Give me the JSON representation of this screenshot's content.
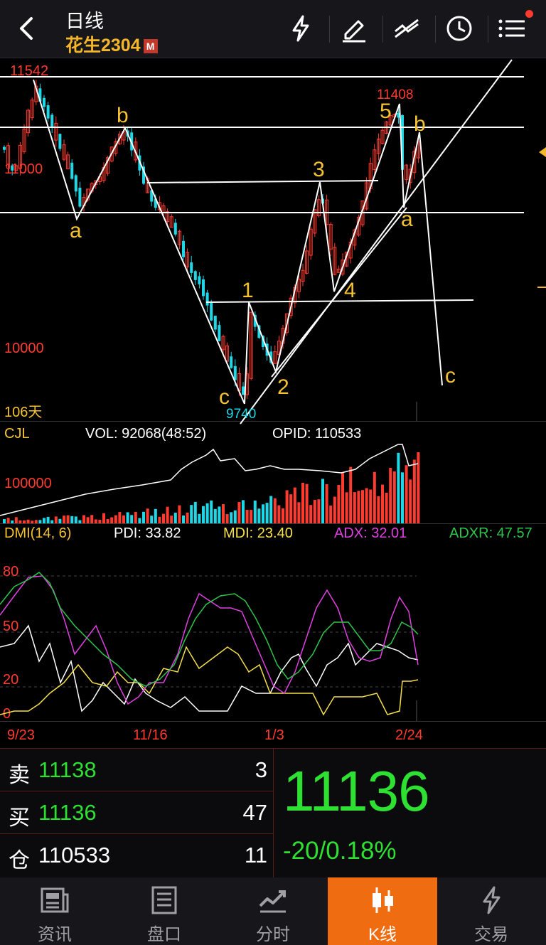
{
  "header": {
    "title": "日线",
    "contract": "花生2304",
    "badge": "M"
  },
  "kline": {
    "price_labels": {
      "high": "11542",
      "p11000": "11000",
      "p10000": "10000"
    },
    "low_label": "9740",
    "high2_label": "11408",
    "days_label": "106天",
    "wave_labels": {
      "a1": "a",
      "b1": "b",
      "c1": "c",
      "w1": "1",
      "w2": "2",
      "w3": "3",
      "w4": "4",
      "w5": "5",
      "a2": "a",
      "b2": "b",
      "c2": "c"
    }
  },
  "volume": {
    "name": "CJL",
    "vol": "VOL: 92068(48:52)",
    "opid": "OPID: 110533",
    "level": "100000"
  },
  "dmi": {
    "name": "DMI(14, 6)",
    "pdi": "PDI: 33.82",
    "mdi": "MDI: 23.40",
    "adx": "ADX: 32.01",
    "adxr": "ADXR: 47.57",
    "levels": [
      "80",
      "50",
      "20",
      "0"
    ]
  },
  "dates": [
    "9/23",
    "11/16",
    "1/3",
    "2/24"
  ],
  "quote": {
    "sell_label": "卖",
    "sell_price": "11138",
    "sell_qty": "3",
    "buy_label": "买",
    "buy_price": "11136",
    "buy_qty": "47",
    "oi_label": "仓",
    "oi_value": "110533",
    "oi_qty": "11",
    "last_price": "11136",
    "change": "-20/0.18%"
  },
  "tabs": [
    {
      "label": "资讯"
    },
    {
      "label": "盘口"
    },
    {
      "label": "分时"
    },
    {
      "label": "K线"
    },
    {
      "label": "交易"
    }
  ],
  "colors": {
    "up": "#ff3b30",
    "down": "#1ed8e8",
    "accent": "#ef6c11",
    "wave_label": "#f5c332",
    "price_green": "#2ee032"
  }
}
